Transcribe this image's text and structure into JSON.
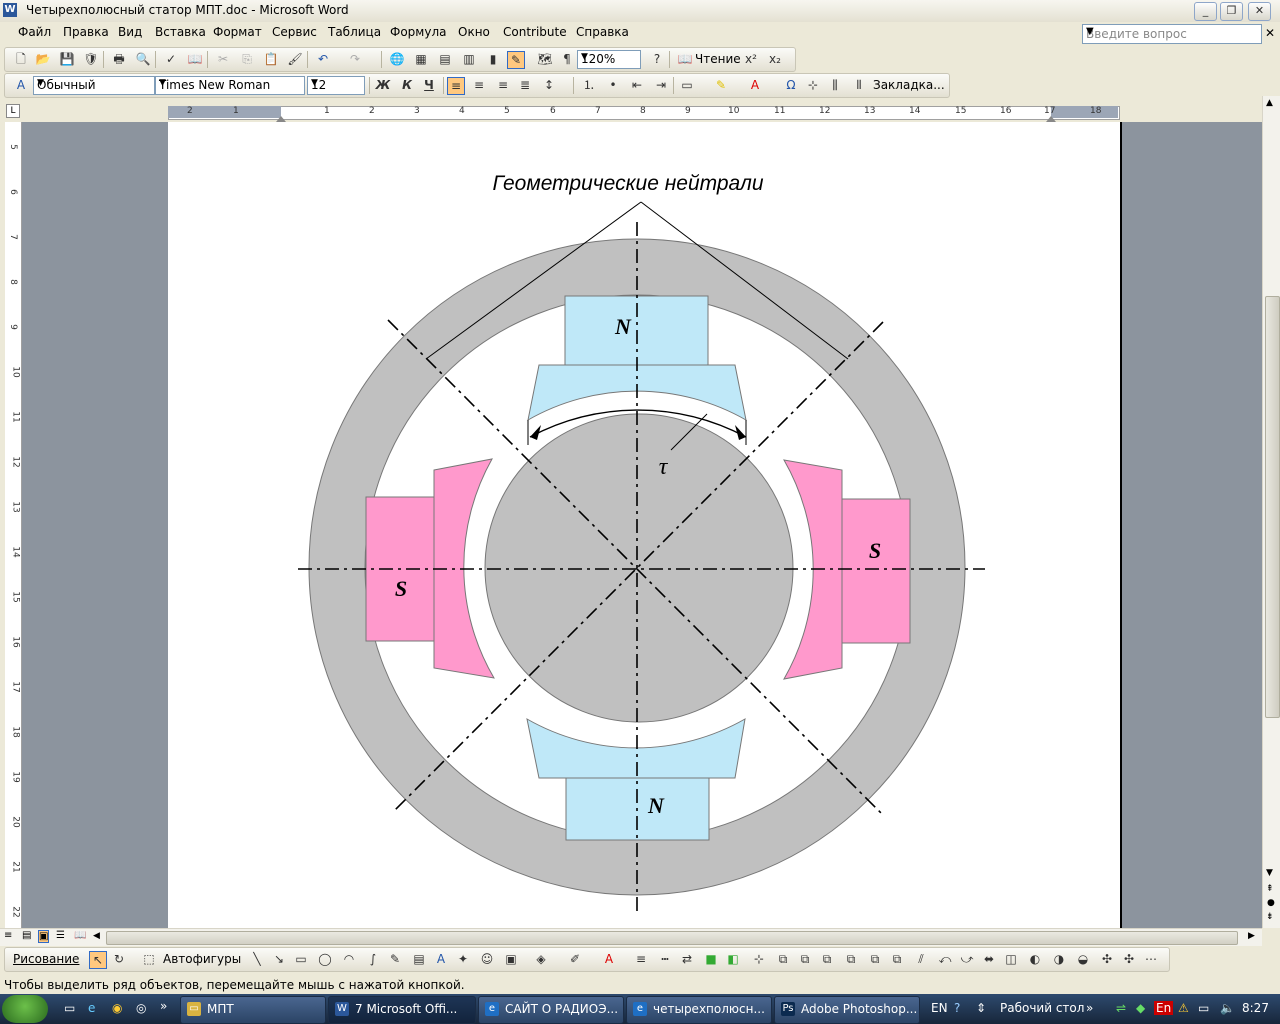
{
  "window": {
    "title": "Четырехполюсный статор МПТ.doc - Microsoft Word",
    "app_icon": "W"
  },
  "menu": {
    "items": [
      "Файл",
      "Правка",
      "Вид",
      "Вставка",
      "Формат",
      "Сервис",
      "Таблица",
      "Формула",
      "Окно",
      "Contribute",
      "Справка"
    ],
    "ask_placeholder": "Введите вопрос"
  },
  "toolbar_standard": {
    "zoom": "120%",
    "reading_label": "Чтение"
  },
  "toolbar_format": {
    "style": "Обычный",
    "font": "Times New Roman",
    "size": "12",
    "bold": "Ж",
    "italic": "К",
    "underline": "Ч",
    "bookmark": "Закладка..."
  },
  "ruler": {
    "h_labels": [
      "2",
      "1",
      "",
      "1",
      "2",
      "3",
      "4",
      "5",
      "6",
      "7",
      "8",
      "9",
      "10",
      "11",
      "12",
      "13",
      "14",
      "15",
      "16",
      "17",
      "18"
    ],
    "v_labels": [
      "5",
      "6",
      "7",
      "8",
      "9",
      "10",
      "11",
      "12",
      "13",
      "14",
      "15",
      "16",
      "17",
      "18",
      "19",
      "20",
      "21",
      "22"
    ]
  },
  "diagram": {
    "caption": "Геометрические нейтрали",
    "pole_top": "N",
    "pole_bottom": "N",
    "pole_left": "S",
    "pole_right": "S",
    "tau": "τ",
    "colors": {
      "yoke": "#C0C0C0",
      "north": "#BFE8F8",
      "south": "#FF99CC",
      "rotor": "#C0C0C0"
    }
  },
  "drawbar": {
    "drawing": "Рисование",
    "autoshapes": "Автофигуры"
  },
  "status": {
    "text": "Чтобы выделить ряд объектов, перемещайте мышь с нажатой кнопкой."
  },
  "taskbar": {
    "tasks": [
      "МПТ",
      "7 Microsoft Offi...",
      "САЙТ О РАДИОЭ...",
      "четырехполюсн...",
      "Adobe Photoshop..."
    ],
    "lang": "EN",
    "desktop": "Рабочий стол",
    "clock": "8:27",
    "tray_lang": "En"
  }
}
